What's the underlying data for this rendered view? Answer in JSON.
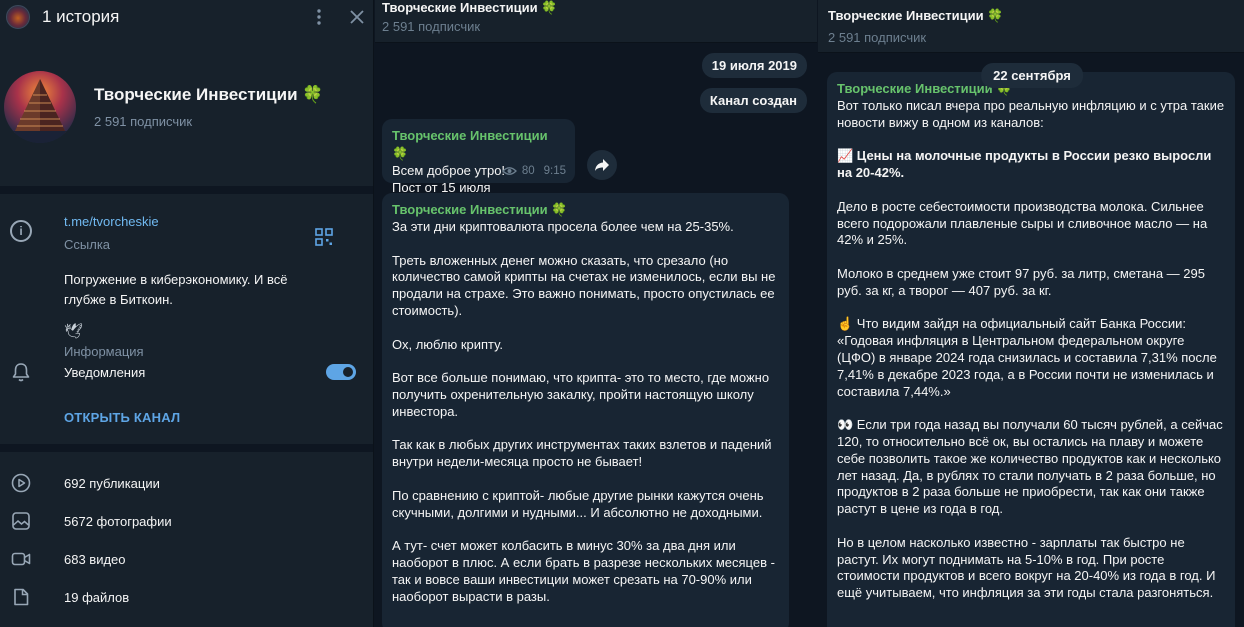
{
  "left_panel": {
    "header_title": "1 история",
    "channel_name": "Творческие Инвестиции 🍀",
    "subscribers": "2 591 подписчик",
    "link": "t.me/tvorcheskie",
    "link_label": "Ссылка",
    "description": "Погружение в киберэкономику. И всё глубже в Биткоин.",
    "dove_emoji": "🕊",
    "info_label": "Информация",
    "notifications_label": "Уведомления",
    "notifications_on": true,
    "open_channel": "ОТКРЫТЬ КАНАЛ",
    "stats": [
      {
        "icon": "video-circle-icon",
        "label": "692 публикации"
      },
      {
        "icon": "photo-icon",
        "label": "5672 фотографии"
      },
      {
        "icon": "video-camera-icon",
        "label": "683 видео"
      },
      {
        "icon": "file-icon",
        "label": "19 файлов"
      }
    ]
  },
  "middle_chat": {
    "title": "Творческие Инвестиции 🍀",
    "subscribers": "2 591 подписчик",
    "date_pill": "19 июля 2019",
    "created_pill": "Канал создан",
    "message1": {
      "author": "Творческие Инвестиции 🍀",
      "text": "Всем доброе утро!\nПост от 15 июля",
      "views": "80",
      "time": "9:15"
    },
    "message2": {
      "author": "Творческие Инвестиции 🍀",
      "text": "За эти дни криптовалюта просела более чем на 25-35%.\n\nТреть вложенных денег можно сказать, что срезало (но количество самой крипты на счетах не изменилось, если вы не продали на страхе. Это важно понимать, просто опустилась ее стоимость).\n\nОх, люблю крипту.\n\nВот все больше понимаю, что крипта- это то место, где можно получить охренительную закалку, пройти настоящую школу инвестора.\n\nТак как в любых других инструментах таких взлетов и падений внутри недели-месяца просто не бывает!\n\nПо сравнению с криптой- любые другие рынки кажутся очень скучными, долгими и нудными... И абсолютно не доходными.\n\nА тут- счет может колбасить в минус 30% за два дня или наоборот в плюс. А если брать в разрезе нескольких месяцев - так и вовсе ваши инвестиции может срезать на 70-90% или наоборот вырасти в разы."
    }
  },
  "right_chat": {
    "title": "Творческие Инвестиции 🍀",
    "subscribers": "2 591 подписчик",
    "date_pill": "22 сентября",
    "message": {
      "author": "Творческие Инвестиции 🍀",
      "p1": "Вот только писал вчера про реальную инфляцию и с утра такие новости вижу в одном из каналов:",
      "headline": "📈 Цены на молочные продукты в России резко выросли на 20-42%.",
      "p2": "Дело в росте себестоимости производства молока. Сильнее всего подорожали плавленые сыры и сливочное масло — на 42% и 25%.",
      "p3": "Молоко в среднем уже стоит 97 руб. за литр, сметана — 295 руб. за кг, а творог — 407 руб. за кг.",
      "p4": "☝️ Что видим зайдя на официальный сайт Банка России:\n«Годовая инфляция в Центральном федеральном округе (ЦФО) в январе 2024 года снизилась и составила 7,31% после 7,41% в декабре 2023 года, а в России почти не изменилась и составила 7,44%.»",
      "p5": "👀 Если три года назад вы получали 60 тысяч рублей, а сейчас 120, то относительно всё ок, вы остались на плаву и можете себе позволить такое же количество продуктов как и несколько лет назад. Да, в рублях то стали получать в 2 раза больше, но продуктов в 2 раза больше не приобрести, так как они также растут в цене из года в год.",
      "p6": "Но в целом насколько известно - зарплаты так быстро не растут. Их могут поднимать на 5-10% в год. При росте стоимости продуктов и всего вокруг на 20-40% из года в год. И ещё учитываем, что инфляция за эти годы стала разгоняться."
    }
  },
  "colors": {
    "panel_bg": "#17212b",
    "chat_bg": "#0e1621",
    "bubble_bg": "#182533",
    "author_green": "#67c36c",
    "link_blue": "#71baf2",
    "accent_blue": "#5ea5e5",
    "muted": "#7f91a4"
  }
}
